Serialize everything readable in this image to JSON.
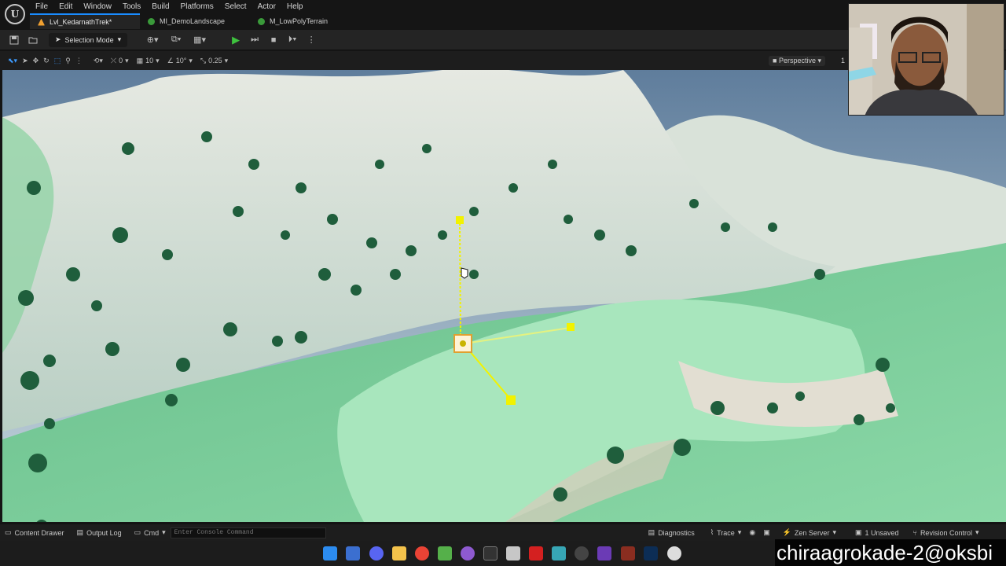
{
  "menu": {
    "items": [
      "File",
      "Edit",
      "Window",
      "Tools",
      "Build",
      "Platforms",
      "Select",
      "Actor",
      "Help"
    ]
  },
  "tabs": [
    {
      "label": "Lvl_KedarnathTrek*",
      "kind": "level",
      "active": true
    },
    {
      "label": "MI_DemoLandscape",
      "kind": "material",
      "active": false
    },
    {
      "label": "M_LowPolyTerrain",
      "kind": "material",
      "active": false
    }
  ],
  "toolbar": {
    "selection_mode": "Selection Mode"
  },
  "viewport_toolbar": {
    "rotation_snap": "0",
    "grid_snap": "10",
    "angle_snap": "10°",
    "scale_snap": "0.25",
    "perspective": "Perspective",
    "extra": "1"
  },
  "statusbar": {
    "content_drawer": "Content Drawer",
    "output_log": "Output Log",
    "cmd": "Cmd",
    "console_placeholder": "Enter Console Command",
    "diagnostics": "Diagnostics",
    "trace": "Trace",
    "zen_server": "Zen Server",
    "unsaved": "1 Unsaved",
    "revision_control": "Revision Control"
  },
  "overlay": {
    "text": "chiraagrokade-2@oksbi"
  },
  "colors": {
    "accent": "#1a8cff",
    "play": "#3ec23e",
    "gizmo": "#f2f200",
    "terrain_green": "#7fcf9a",
    "trees": "#1f5e3c"
  }
}
